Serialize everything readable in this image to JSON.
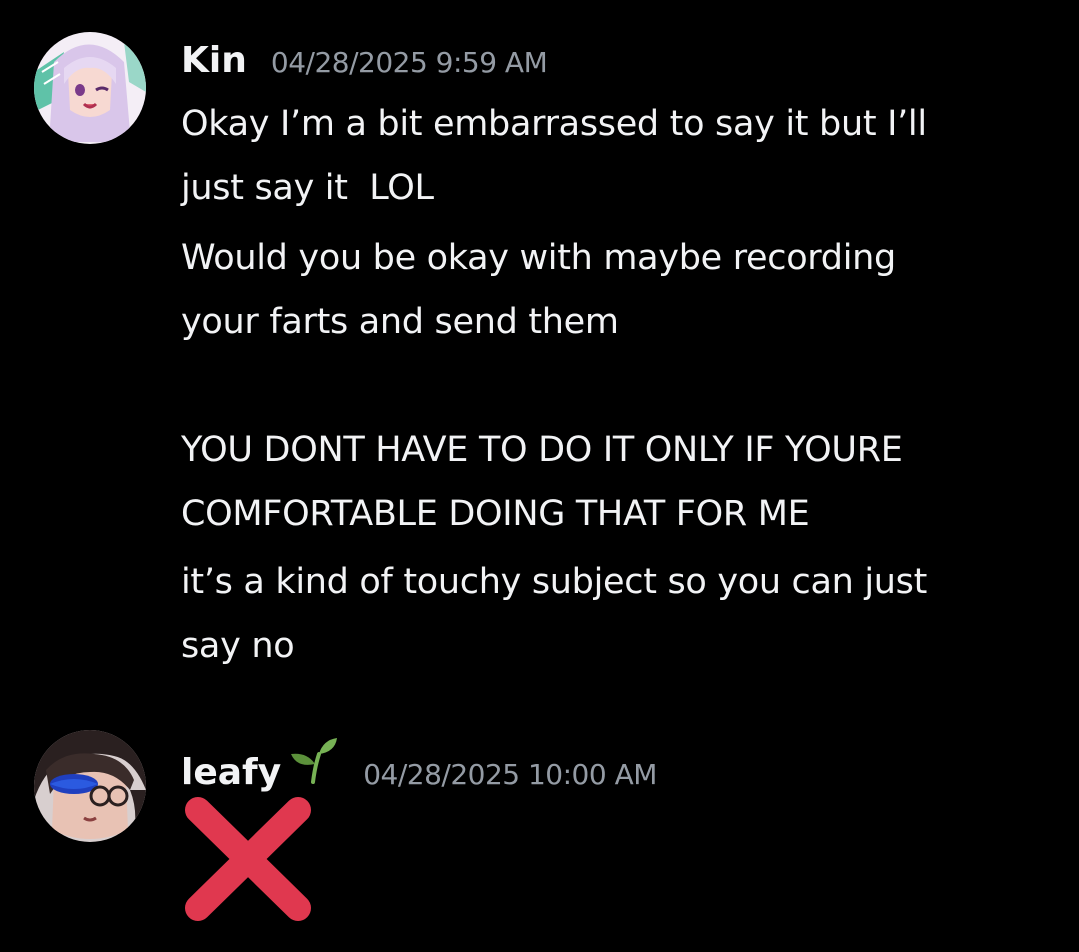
{
  "messages": [
    {
      "author": "Kin",
      "timestamp": "04/28/2025 9:59 AM",
      "lines": [
        "Okay I’m a bit embarrassed to say it but I’ll\njust say it  LOL",
        "Would you be okay with maybe recording\nyour farts and send them\n\nYOU DONT HAVE TO DO IT ONLY IF YOURE\nCOMFORTABLE DOING THAT FOR ME",
        "it’s a kind of touchy subject so you can just\nsay no"
      ]
    },
    {
      "author": "leafy",
      "author_icon": "seedling-icon",
      "timestamp": "04/28/2025 10:00 AM",
      "content_icon": "cross-mark-icon"
    }
  ],
  "colors": {
    "background": "#000000",
    "text": "#f2f3f5",
    "timestamp": "#949ba4",
    "cross_mark": "#e0384f",
    "seedling": "#77b255"
  }
}
